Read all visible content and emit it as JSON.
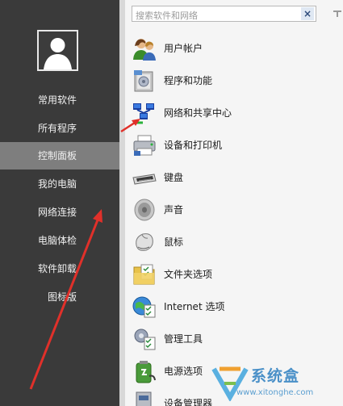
{
  "sidebar": {
    "items": [
      {
        "label": "常用软件"
      },
      {
        "label": "所有程序"
      },
      {
        "label": "控制面板",
        "active": true
      },
      {
        "label": "我的电脑"
      },
      {
        "label": "网络连接"
      },
      {
        "label": "电脑体检"
      },
      {
        "label": "软件卸载"
      },
      {
        "label": "图标版"
      }
    ]
  },
  "search": {
    "placeholder": "搜索软件和网络",
    "value": "",
    "clear_icon": "close-icon"
  },
  "control_panel": {
    "items": [
      {
        "label": "用户帐户",
        "icon": "user-accounts-icon"
      },
      {
        "label": "程序和功能",
        "icon": "programs-features-icon"
      },
      {
        "label": "网络和共享中心",
        "icon": "network-sharing-icon"
      },
      {
        "label": "设备和打印机",
        "icon": "printer-icon"
      },
      {
        "label": "键盘",
        "icon": "keyboard-icon"
      },
      {
        "label": "声音",
        "icon": "speaker-icon"
      },
      {
        "label": "鼠标",
        "icon": "mouse-icon"
      },
      {
        "label": "文件夹选项",
        "icon": "folder-options-icon"
      },
      {
        "label": "Internet 选项",
        "icon": "internet-options-icon"
      },
      {
        "label": "管理工具",
        "icon": "admin-tools-icon"
      },
      {
        "label": "电源选项",
        "icon": "power-options-icon"
      },
      {
        "label": "设备管理器",
        "icon": "device-manager-icon"
      }
    ]
  },
  "watermark": {
    "text": "系统盒",
    "url": "www.xitonghe.com"
  },
  "colors": {
    "sidebar_bg": "#3a3a3a",
    "sidebar_active": "#7e7e7e",
    "main_bg": "#f5f5f5",
    "annotation_arrow": "#e0302a"
  }
}
